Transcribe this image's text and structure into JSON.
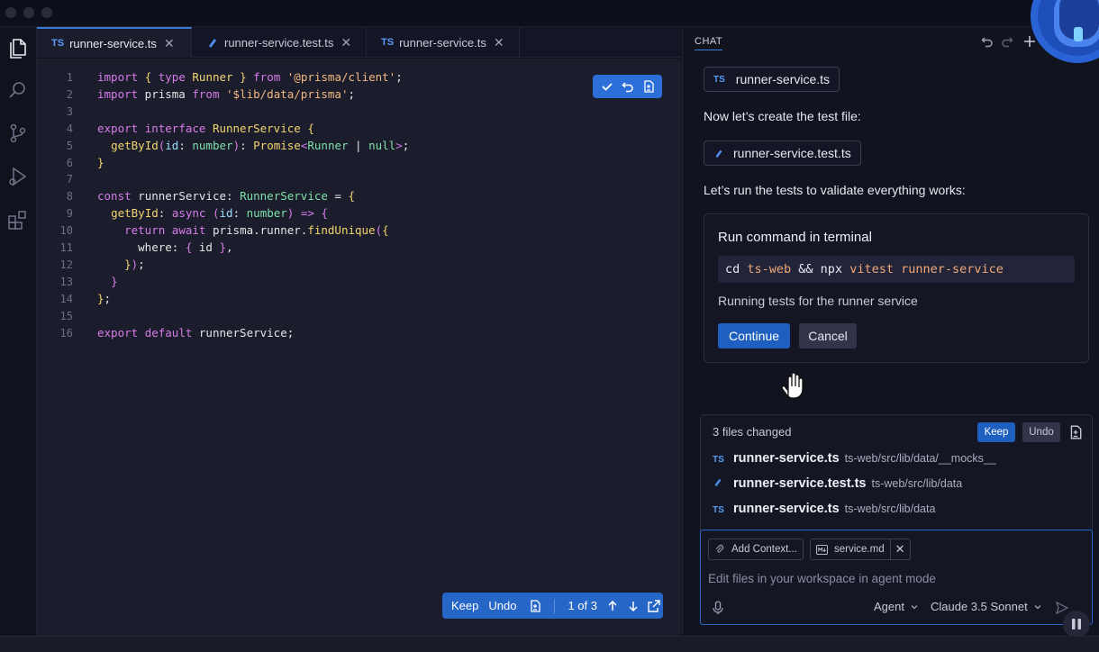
{
  "editor": {
    "tabs": [
      {
        "badge": "TS",
        "label": "runner-service.ts"
      },
      {
        "badge": "",
        "label": "runner-service.test.ts"
      },
      {
        "badge": "TS",
        "label": "runner-service.ts"
      }
    ],
    "line_numbers": [
      "1",
      "2",
      "3",
      "4",
      "5",
      "6",
      "7",
      "8",
      "9",
      "10",
      "11",
      "12",
      "13",
      "14",
      "15",
      "16"
    ],
    "bottom_bar": {
      "keep_label": "Keep",
      "undo_label": "Undo",
      "page_indicator": "1 of 3"
    }
  },
  "chat": {
    "title": "CHAT",
    "file_chip_1": {
      "badge": "TS",
      "label": "runner-service.ts"
    },
    "msg_create_test": "Now let’s create the test file:",
    "file_chip_2": {
      "label": "runner-service.test.ts"
    },
    "msg_run_tests": "Let’s run the tests to validate everything works:",
    "command_card": {
      "title": "Run command in terminal",
      "command": "cd ts-web && npx vitest runner-service",
      "description": "Running tests for the runner service",
      "continue_label": "Continue",
      "cancel_label": "Cancel"
    },
    "changes": {
      "summary": "3 files changed",
      "keep_label": "Keep",
      "undo_label": "Undo",
      "files": [
        {
          "badge": "TS",
          "name": "runner-service.ts",
          "path": "ts-web/src/lib/data/__mocks__"
        },
        {
          "badge": "",
          "name": "runner-service.test.ts",
          "path": "ts-web/src/lib/data"
        },
        {
          "badge": "TS",
          "name": "runner-service.ts",
          "path": "ts-web/src/lib/data"
        }
      ]
    },
    "input": {
      "add_context_label": "Add Context...",
      "context_file": "service.md",
      "placeholder": "Edit files in your workspace in agent mode",
      "mode": "Agent",
      "model": "Claude 3.5 Sonnet"
    }
  }
}
